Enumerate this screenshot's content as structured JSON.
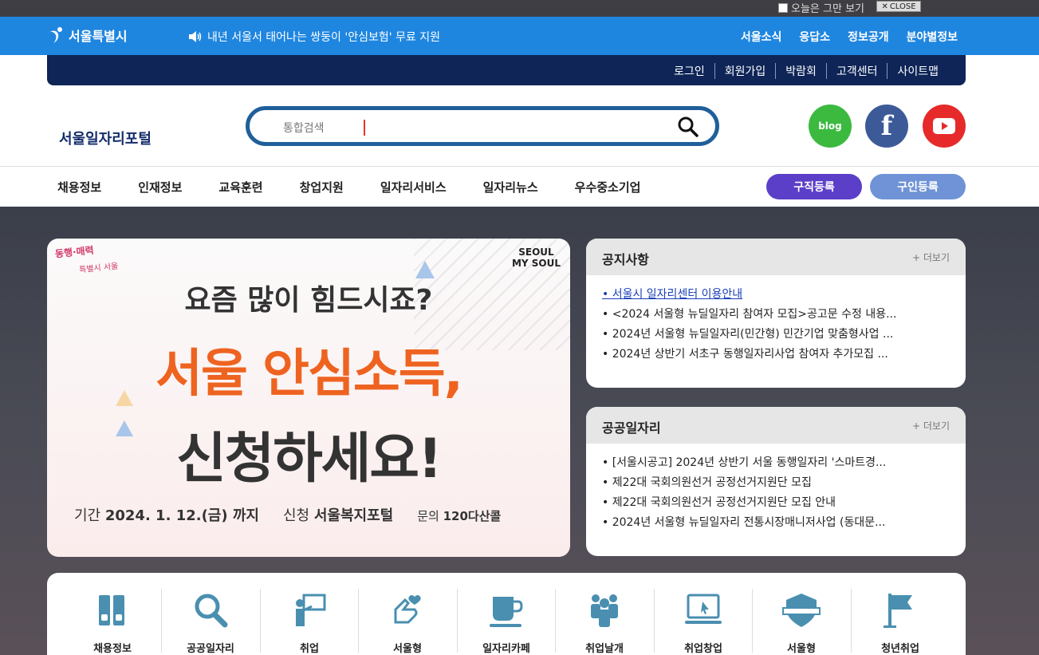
{
  "popup": {
    "dismiss_label": "오늘은 그만 보기",
    "close_label": "CLOSE"
  },
  "city": {
    "logo": "서울특별시",
    "ticker": "내년 서울서 태어나는 쌍둥이 '안심보험' 무료 지원",
    "menu": [
      "서울소식",
      "응답소",
      "정보공개",
      "분야별정보"
    ]
  },
  "util": [
    "로그인",
    "회원가입",
    "박람회",
    "고객센터",
    "사이트맵"
  ],
  "header": {
    "site_title": "서울일자리포털",
    "search_placeholder": "통합검색",
    "social": {
      "blog": "blog",
      "facebook": "f"
    }
  },
  "nav": [
    "채용정보",
    "인재정보",
    "교육훈련",
    "창업지원",
    "일자리서비스",
    "일자리뉴스",
    "우수중소기업"
  ],
  "cta": {
    "job_register": "구직등록",
    "hire_register": "구인등록"
  },
  "banner": {
    "brand_line1": "동행·매력",
    "brand_line2": "특별시 서울",
    "soul_line1": "SEOUL",
    "soul_line2": "MY SOUL",
    "subtitle": "요즘 많이 힘드시죠?",
    "title": "서울 안심소득,",
    "cta": "신청하세요!",
    "period_label": "기간",
    "period_value": "2024. 1. 12.(금) 까지",
    "apply_label": "신청",
    "apply_value": "서울복지포털",
    "inquiry_label": "문의",
    "inquiry_value": "120다산콜"
  },
  "notice": {
    "title": "공지사항",
    "more": "+ 더보기",
    "items": [
      "• 서울시 일자리센터 이용안내",
      "• <2024 서울형 뉴딜일자리 참여자 모집>공고문 수정 내용...",
      "• 2024년 서울형 뉴딜일자리(민간형) 민간기업 맞춤형사업 ...",
      "• 2024년 상반기 서초구 동행일자리사업 참여자 추가모집 ..."
    ]
  },
  "public_jobs": {
    "title": "공공일자리",
    "more": "+ 더보기",
    "items": [
      "• [서울시공고] 2024년 상반기 서울 동행일자리 '스마트경...",
      "• 제22대 국회의원선거 공정선거지원단 모집",
      "• 제22대 국회의원선거 공정선거지원단 모집 안내",
      "• 2024년 서울형 뉴딜일자리 전통시장매니저사업 (동대문..."
    ]
  },
  "quick": [
    {
      "label": "채용정보",
      "icon": "binder-icon"
    },
    {
      "label": "공공일자리",
      "icon": "magnifier-icon"
    },
    {
      "label": "취업",
      "icon": "presenter-icon"
    },
    {
      "label": "서울형",
      "icon": "heart-hand-icon"
    },
    {
      "label": "일자리카페",
      "icon": "coffee-cup-icon"
    },
    {
      "label": "취업날개",
      "icon": "people-icon"
    },
    {
      "label": "취업창업",
      "icon": "laptop-icon"
    },
    {
      "label": "서울형",
      "icon": "badge-icon"
    },
    {
      "label": "청년취업",
      "icon": "flag-icon"
    }
  ],
  "colors": {
    "accent": "#1f86e0",
    "navy": "#0f2558",
    "purple": "#5b3fc8",
    "icon": "#4a8fb0",
    "orange": "#ee6320"
  }
}
